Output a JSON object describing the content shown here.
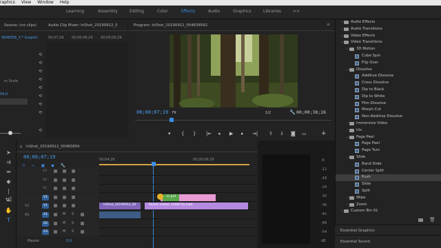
{
  "menu": [
    "raphics",
    "View",
    "Window",
    "Help"
  ],
  "workspaces": {
    "tabs": [
      {
        "label": "Learning",
        "active": false
      },
      {
        "label": "Assembly",
        "active": false
      },
      {
        "label": "Editing",
        "active": false
      },
      {
        "label": "Color",
        "active": false
      },
      {
        "label": "Effects",
        "active": true
      },
      {
        "label": "Audio",
        "active": false
      },
      {
        "label": "Graphics",
        "active": false
      },
      {
        "label": "Libraries",
        "active": false
      }
    ],
    "more": ">>"
  },
  "source_panel": {
    "tab_source": "Source: (no clips)",
    "tab_mixer": "Audio Clip Mixer: InShot_20190912_0",
    "clip_name": "9048356_2 * Graphic",
    "timecodes": [
      "00;07;29",
      "00;00;08;29",
      "00;00;09;29"
    ],
    "prop_label": "m Scale",
    "value1": "54.0",
    "value2": "100"
  },
  "program_panel": {
    "title": "Program: InShot_20190912_004838562",
    "timecode_current": "00;00;07;19",
    "fit": "Fit",
    "resolution": "1/2",
    "timecode_total": "00;00;38;26"
  },
  "effects_panel": {
    "items": [
      {
        "label": "Audio Effects",
        "level": 0,
        "kind": "folder",
        "open": false,
        "selected": false
      },
      {
        "label": "Audio Transitions",
        "level": 0,
        "kind": "folder",
        "open": false,
        "selected": false
      },
      {
        "label": "Video Effects",
        "level": 0,
        "kind": "folder",
        "open": false,
        "selected": false
      },
      {
        "label": "Video Transitions",
        "level": 0,
        "kind": "folder",
        "open": true,
        "selected": false
      },
      {
        "label": "3D Motion",
        "level": 1,
        "kind": "folder",
        "open": true,
        "selected": false
      },
      {
        "label": "Cube Spin",
        "level": 2,
        "kind": "effect",
        "selected": false
      },
      {
        "label": "Flip Over",
        "level": 2,
        "kind": "effect",
        "selected": false
      },
      {
        "label": "Dissolve",
        "level": 1,
        "kind": "folder",
        "open": true,
        "selected": false
      },
      {
        "label": "Additive Dissolve",
        "level": 2,
        "kind": "effect",
        "selected": false
      },
      {
        "label": "Cross Dissolve",
        "level": 2,
        "kind": "effect",
        "selected": false
      },
      {
        "label": "Dip to Black",
        "level": 2,
        "kind": "effect",
        "selected": false
      },
      {
        "label": "Dip to White",
        "level": 2,
        "kind": "effect",
        "selected": false
      },
      {
        "label": "Film Dissolve",
        "level": 2,
        "kind": "effect",
        "selected": false
      },
      {
        "label": "Morph Cut",
        "level": 2,
        "kind": "effect",
        "selected": false
      },
      {
        "label": "Non-Additive Dissolve",
        "level": 2,
        "kind": "effect",
        "selected": false
      },
      {
        "label": "Immersive Video",
        "level": 1,
        "kind": "folder",
        "open": false,
        "selected": false
      },
      {
        "label": "Iris",
        "level": 1,
        "kind": "folder",
        "open": false,
        "selected": false
      },
      {
        "label": "Page Peel",
        "level": 1,
        "kind": "folder",
        "open": true,
        "selected": false
      },
      {
        "label": "Page Peel",
        "level": 2,
        "kind": "effect",
        "selected": false
      },
      {
        "label": "Page Turn",
        "level": 2,
        "kind": "effect",
        "selected": false
      },
      {
        "label": "Slide",
        "level": 1,
        "kind": "folder",
        "open": true,
        "selected": false
      },
      {
        "label": "Band Slide",
        "level": 2,
        "kind": "effect",
        "selected": false
      },
      {
        "label": "Center Split",
        "level": 2,
        "kind": "effect",
        "selected": false
      },
      {
        "label": "Push",
        "level": 2,
        "kind": "effect",
        "selected": true
      },
      {
        "label": "Slide",
        "level": 2,
        "kind": "effect",
        "selected": false
      },
      {
        "label": "Split",
        "level": 2,
        "kind": "effect",
        "selected": false
      },
      {
        "label": "Wipe",
        "level": 1,
        "kind": "folder",
        "open": false,
        "selected": false
      },
      {
        "label": "Zoom",
        "level": 1,
        "kind": "folder",
        "open": false,
        "selected": false
      },
      {
        "label": "Custom Bin 01",
        "level": 0,
        "kind": "folder",
        "open": false,
        "selected": false
      }
    ],
    "essential_graphics": "Essential Graphics",
    "essential_sound": "Essential Sound"
  },
  "timeline": {
    "tab_title": "InShot_20190912_00483856",
    "timecode": "00;00;07;19",
    "ruler": [
      "00;04;29",
      "00;00;09;29"
    ],
    "tracks": [
      {
        "name": "V3",
        "kind": "video"
      },
      {
        "name": "V2",
        "kind": "video"
      },
      {
        "name": "V1",
        "kind": "video"
      },
      {
        "name": "V1",
        "kind": "video",
        "target": true
      },
      {
        "name": "V1",
        "kind": "video",
        "target": true,
        "src": "V1"
      },
      {
        "name": "A1",
        "kind": "audio",
        "target": true,
        "src": "A1"
      },
      {
        "name": "A2",
        "kind": "audio"
      },
      {
        "name": "A3",
        "kind": "audio"
      }
    ],
    "track_labels": [
      "V3",
      "V2",
      "V1",
      "V1",
      "V1",
      "A1",
      "A2",
      "A3"
    ],
    "mute_label": "M",
    "solo_label": "S",
    "master_label": "Master",
    "master_value": "0.0",
    "clips": {
      "clip1": "InShot_20190912_00",
      "clip2": "Pexels Videos 1448735.mp4",
      "graphic": "Push",
      "trans": "In JuH"
    }
  },
  "vu": {
    "labels": [
      "-6",
      "-12",
      "-18",
      "-24",
      "-30",
      "-36",
      "-42",
      "-48",
      "-54",
      "dB"
    ]
  },
  "colors": {
    "accent": "#3a8ee6",
    "clip_video": "#b48ae0",
    "clip_graphic": "#e89ad4",
    "clip_audio": "#3e5c86"
  }
}
